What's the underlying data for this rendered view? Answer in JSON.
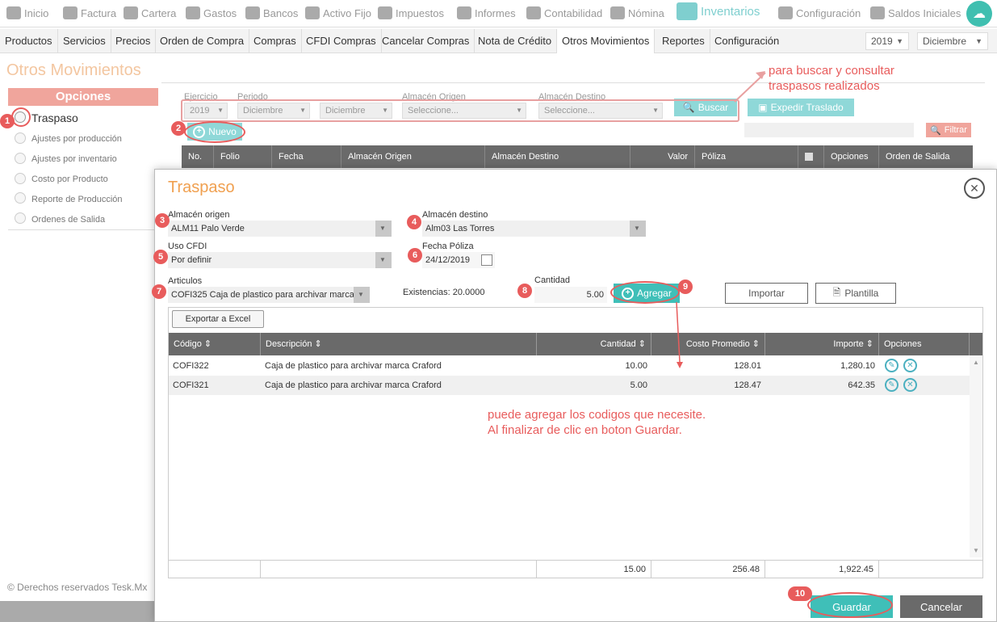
{
  "topnav": {
    "items": [
      "Inicio",
      "Factura",
      "Cartera",
      "Gastos",
      "Bancos",
      "Activo Fijo",
      "Impuestos",
      "Informes",
      "Contabilidad",
      "Nómina",
      "Inventarios",
      "Configuración",
      "Saldos Iniciales"
    ],
    "active": "Inventarios"
  },
  "subnav": {
    "tabs": [
      "Productos",
      "Servicios",
      "Precios",
      "Orden de Compra",
      "Compras",
      "CFDI Compras",
      "Cancelar Compras",
      "Nota de Crédito",
      "Otros Movimientos",
      "Reportes",
      "Configuración"
    ],
    "active": "Otros Movimientos",
    "year": "2019",
    "month": "Diciembre"
  },
  "page": {
    "title": "Otros Movimientos",
    "options_title": "Opciones",
    "options": [
      "Traspaso",
      "Ajustes por producción",
      "Ajustes por inventario",
      "Costo por Producto",
      "Reporte de Producción",
      "Ordenes de Salida"
    ],
    "copyright": "© Derechos reservados Tesk.Mx"
  },
  "filters": {
    "ejercicio_label": "Ejercicio",
    "ejercicio": "2019",
    "periodo_label": "Periodo",
    "periodo_from": "Diciembre",
    "periodo_to": "Diciembre",
    "origen_label": "Almacén Origen",
    "origen_placeholder": "Seleccione...",
    "destino_label": "Almacén Destino",
    "destino_placeholder": "Seleccione...",
    "buscar": "Buscar",
    "expedir": "Expedir Traslado",
    "nuevo": "Nuevo",
    "filtrar": "Filtrar"
  },
  "bg_table": {
    "headers": [
      "No.",
      "Folio",
      "Fecha",
      "Almacén Origen",
      "Almacén Destino",
      "Valor",
      "Póliza",
      "",
      "Opciones",
      "Orden de Salida"
    ]
  },
  "modal": {
    "title": "Traspaso",
    "almacen_origen_label": "Almacén origen",
    "almacen_origen": "ALM11 Palo Verde",
    "almacen_destino_label": "Almacén destino",
    "almacen_destino": "Alm03 Las Torres",
    "uso_cfdi_label": "Uso CFDI",
    "uso_cfdi": "Por definir",
    "fecha_poliza_label": "Fecha Póliza",
    "fecha_poliza": "24/12/2019",
    "articulos_label": "Articulos",
    "articulo": "COFI325 Caja de plastico para archivar marca Craford",
    "existencias": "Existencias: 20.0000",
    "cantidad_label": "Cantidad",
    "cantidad": "5.00",
    "agregar": "Agregar",
    "importar": "Importar",
    "plantilla": "Plantilla",
    "exportar": "Exportar a Excel",
    "guardar": "Guardar",
    "cancelar": "Cancelar"
  },
  "grid": {
    "headers": [
      "Código",
      "Descripción",
      "Cantidad",
      "Costo Promedio",
      "Importe",
      "Opciones"
    ],
    "rows": [
      {
        "codigo": "COFI322",
        "descripcion": "Caja de plastico para archivar marca Craford",
        "cantidad": "10.00",
        "costo": "128.01",
        "importe": "1,280.10"
      },
      {
        "codigo": "COFI321",
        "descripcion": "Caja de plastico para archivar marca Craford",
        "cantidad": "5.00",
        "costo": "128.47",
        "importe": "642.35"
      }
    ],
    "totals": {
      "cantidad": "15.00",
      "costo": "256.48",
      "importe": "1,922.45"
    }
  },
  "annotations": {
    "note1_line1": "para buscar y consultar",
    "note1_line2": "traspasos realizados",
    "note2_line1": "puede agregar los codigos que necesite.",
    "note2_line2": "Al finalizar de clic en boton Guardar.",
    "markers": [
      "1",
      "2",
      "3",
      "4",
      "5",
      "6",
      "7",
      "8",
      "9",
      "10"
    ]
  },
  "colors": {
    "accent": "#3fbfb8",
    "salmon": "#f0a59c",
    "annotation": "#e85c5c",
    "header_dark": "#6a6a6a"
  }
}
